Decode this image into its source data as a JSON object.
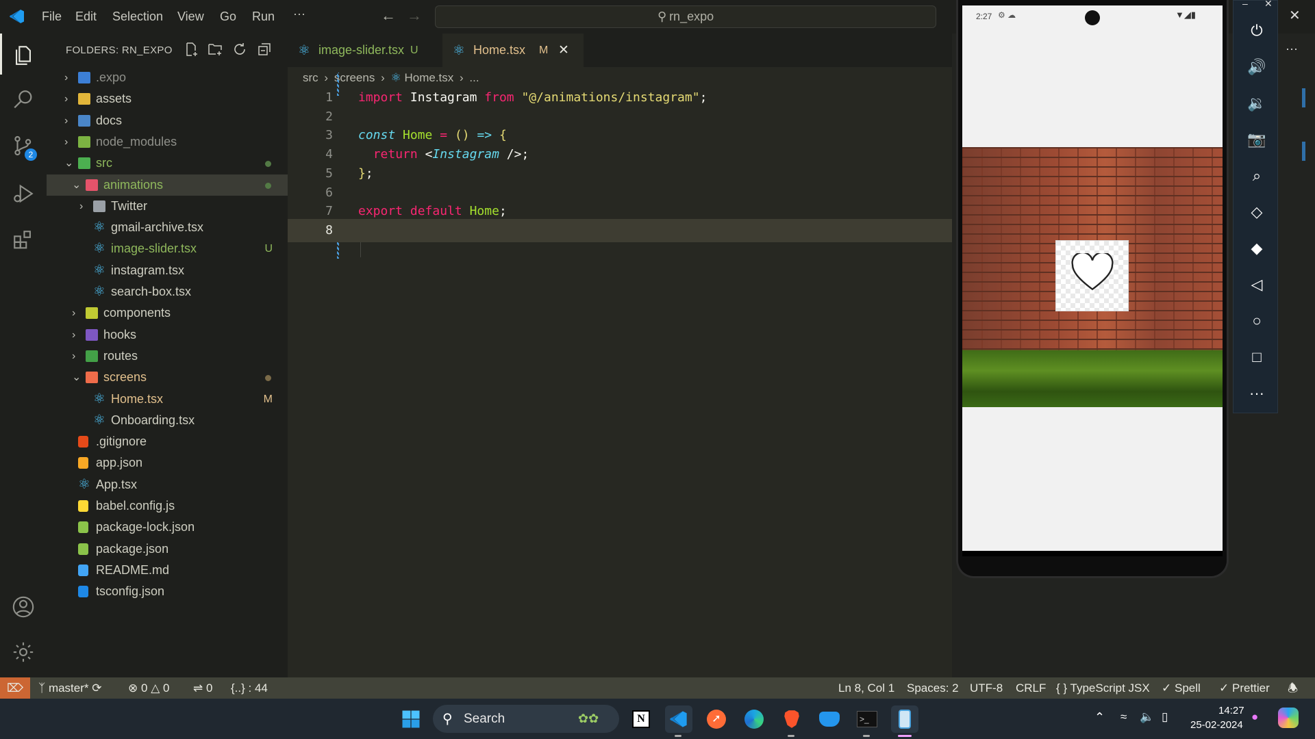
{
  "titlebar": {
    "menu": [
      "File",
      "Edit",
      "Selection",
      "View",
      "Go",
      "Run",
      "···"
    ],
    "search_text": "rn_expo",
    "window_controls": [
      "–",
      "✕"
    ]
  },
  "activitybar": {
    "scm_badge": "2",
    "icons": [
      "files-icon",
      "search-icon",
      "source-control-icon",
      "run-debug-icon",
      "extensions-icon",
      "account-icon",
      "settings-gear-icon"
    ]
  },
  "sidebar": {
    "title": "FOLDERS: RN_EXPO",
    "items": [
      {
        "label": ".expo",
        "indent": 0,
        "chev": "›",
        "icon": "#3c7fd6",
        "muted": true
      },
      {
        "label": "assets",
        "indent": 0,
        "chev": "›",
        "icon": "#e2b63a"
      },
      {
        "label": "docs",
        "indent": 0,
        "chev": "›",
        "icon": "#4a86c8"
      },
      {
        "label": "node_modules",
        "indent": 0,
        "chev": "›",
        "icon": "#7cb342",
        "muted": true
      },
      {
        "label": "src",
        "indent": 0,
        "chev": "⌄",
        "icon": "#4caf50",
        "dot": true,
        "green": true
      },
      {
        "label": "animations",
        "indent": 1,
        "chev": "⌄",
        "icon": "#e5536a",
        "dot": true,
        "green": true,
        "selected": true
      },
      {
        "label": "Twitter",
        "indent": 2,
        "chev": "›",
        "icon": "#9aa0a6"
      },
      {
        "label": "gmail-archive.tsx",
        "indent": 2,
        "react": true
      },
      {
        "label": "image-slider.tsx",
        "indent": 2,
        "react": true,
        "badge": "U",
        "green": true
      },
      {
        "label": "instagram.tsx",
        "indent": 2,
        "react": true
      },
      {
        "label": "search-box.tsx",
        "indent": 2,
        "react": true
      },
      {
        "label": "components",
        "indent": 1,
        "chev": "›",
        "icon": "#c0ca33"
      },
      {
        "label": "hooks",
        "indent": 1,
        "chev": "›",
        "icon": "#7e57c2"
      },
      {
        "label": "routes",
        "indent": 1,
        "chev": "›",
        "icon": "#43a047"
      },
      {
        "label": "screens",
        "indent": 1,
        "chev": "⌄",
        "icon": "#ef6c4a",
        "dot": true,
        "amber": true
      },
      {
        "label": "Home.tsx",
        "indent": 2,
        "react": true,
        "badge": "M",
        "amber": true
      },
      {
        "label": "Onboarding.tsx",
        "indent": 2,
        "react": true
      },
      {
        "label": ".gitignore",
        "indent": 0,
        "file": "#e64a19"
      },
      {
        "label": "app.json",
        "indent": 0,
        "file": "#f9a825"
      },
      {
        "label": "App.tsx",
        "indent": 0,
        "react": true
      },
      {
        "label": "babel.config.js",
        "indent": 0,
        "file": "#fdd835"
      },
      {
        "label": "package-lock.json",
        "indent": 0,
        "file": "#8bc34a"
      },
      {
        "label": "package.json",
        "indent": 0,
        "file": "#8bc34a"
      },
      {
        "label": "README.md",
        "indent": 0,
        "file": "#42a5f5"
      },
      {
        "label": "tsconfig.json",
        "indent": 0,
        "file": "#1e88e5"
      }
    ]
  },
  "tabs": [
    {
      "label": "image-slider.tsx",
      "badge": "U",
      "active": false
    },
    {
      "label": "Home.tsx",
      "badge": "M",
      "active": true
    }
  ],
  "breadcrumb": [
    "src",
    "screens",
    "Home.tsx",
    "..."
  ],
  "code": [
    {
      "n": "1",
      "html": "<span class='kw'>import</span> <span class='pl'>Instagram</span> <span class='kw'>from</span> <span class='str'>\"@/animations/instagram\"</span><span class='pl'>;</span>"
    },
    {
      "n": "2",
      "html": ""
    },
    {
      "n": "3",
      "html": "<span class='kwi'>const</span> <span class='fn'>Home</span> <span class='kw'>=</span> <span class='str'>()</span> <span class='kwi'>=&gt;</span> <span class='str'>{</span>"
    },
    {
      "n": "4",
      "html": "  <span class='kw'>return</span> <span class='pl'>&lt;</span><span class='cls'>Instagram</span> <span class='pl'>/&gt;;</span>"
    },
    {
      "n": "5",
      "html": "<span class='str'>}</span><span class='pl'>;</span>"
    },
    {
      "n": "6",
      "html": ""
    },
    {
      "n": "7",
      "html": "<span class='kw'>export</span> <span class='kw'>default</span> <span class='fn'>Home</span><span class='pl'>;</span>"
    },
    {
      "n": "8",
      "html": ""
    }
  ],
  "emulator": {
    "time": "2:27",
    "controls": [
      "power-icon",
      "volume-up-icon",
      "volume-down-icon",
      "camera-icon",
      "zoom-icon",
      "rotate-left-icon",
      "rotate-right-icon",
      "back-icon",
      "home-icon",
      "overview-icon",
      "more-icon"
    ]
  },
  "statusbar": {
    "branch": "master*",
    "errors": "0",
    "warnings": "0",
    "ports": "0",
    "json_count": "{..} : 44",
    "position": "Ln 8, Col 1",
    "spaces": "Spaces: 2",
    "encoding": "UTF-8",
    "eol": "CRLF",
    "language": "TypeScript JSX",
    "spell": "Spell",
    "prettier": "Prettier"
  },
  "taskbar": {
    "search_label": "Search",
    "time": "14:27",
    "date": "25-02-2024"
  }
}
